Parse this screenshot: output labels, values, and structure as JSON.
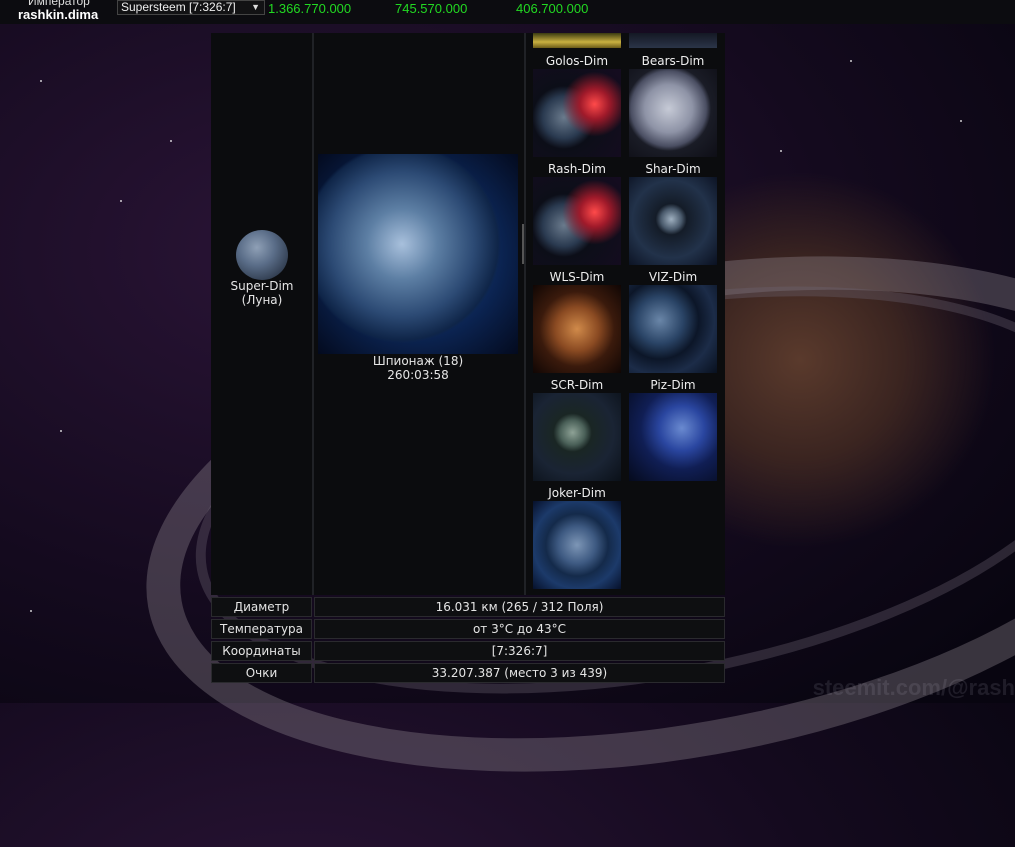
{
  "header": {
    "emperor_title": "Император",
    "emperor_name": "rashkin.dima",
    "planet_select": "Supersteem [7:326:7]",
    "resources": [
      "1.366.770.000",
      "745.570.000",
      "406.700.000"
    ]
  },
  "moon": {
    "name": "Super-Dim",
    "subtitle": "(Луна)"
  },
  "main_planet": {
    "task": "Шпионаж (18)",
    "timer": "260:03:58"
  },
  "planets": [
    {
      "name": "Golos-Dim"
    },
    {
      "name": "Bears-Dim"
    },
    {
      "name": "Rash-Dim"
    },
    {
      "name": "Shar-Dim"
    },
    {
      "name": "WLS-Dim"
    },
    {
      "name": "VIZ-Dim"
    },
    {
      "name": "SCR-Dim"
    },
    {
      "name": "Piz-Dim"
    },
    {
      "name": "Joker-Dim"
    }
  ],
  "info": [
    {
      "label": "Диаметр",
      "value": "16.031 км (265 / 312 Поля)"
    },
    {
      "label": "Температура",
      "value": "от 3°C до 43°C"
    },
    {
      "label": "Координаты",
      "value": "[7:326:7]"
    },
    {
      "label": "Очки",
      "value": "33.207.387 (место 3 из 439)"
    }
  ],
  "watermark": "steemit.com/@rash"
}
